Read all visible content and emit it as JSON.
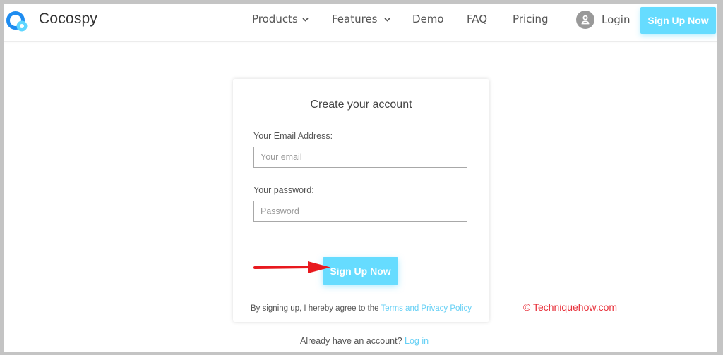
{
  "header": {
    "brand": "Cocospy",
    "nav": [
      {
        "label": "Products",
        "has_dropdown": true
      },
      {
        "label": "Features",
        "has_dropdown": true
      },
      {
        "label": "Demo",
        "has_dropdown": false
      },
      {
        "label": "FAQ",
        "has_dropdown": false
      },
      {
        "label": "Pricing",
        "has_dropdown": false
      }
    ],
    "login_label": "Login",
    "signup_label": "Sign Up Now"
  },
  "form": {
    "title": "Create your account",
    "email_label": "Your Email Address:",
    "email_placeholder": "Your email",
    "email_value": "",
    "password_label": "Your password:",
    "password_placeholder": "Password",
    "password_value": "",
    "submit_label": "Sign Up Now",
    "terms_prefix": "By signing up, I hereby agree to the ",
    "terms_link": "Terms and Privacy Policy"
  },
  "footer": {
    "already_text": "Already have an account? ",
    "login_link": "Log in"
  },
  "watermark": "© Techniquehow.com",
  "colors": {
    "accent": "#66dcff",
    "link": "#66d0f5",
    "annotation_arrow": "#e8191e",
    "watermark": "#e8323c"
  }
}
